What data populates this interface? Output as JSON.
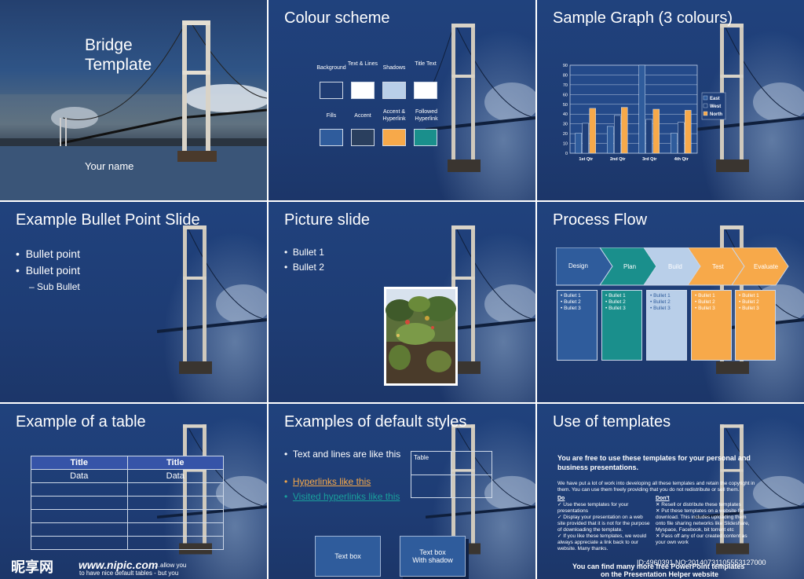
{
  "slide1": {
    "title_line1": "Bridge",
    "title_line2": "Template",
    "subtitle": "Your name"
  },
  "slide2": {
    "title": "Colour scheme",
    "row1_labels": [
      "Background",
      "Text & Lines",
      "Shadows",
      "Title Text"
    ],
    "row2_labels": [
      "Fills",
      "Accent",
      "Accent & Hyperlink",
      "Followed Hyperlink"
    ],
    "row1_colors": [
      "#1f3c73",
      "#ffffff",
      "#b9cfe9",
      "#ffffff"
    ],
    "row2_colors": [
      "#2f5c9c",
      "#2a3f5e",
      "#f7a94a",
      "#1a8f8c"
    ]
  },
  "slide3": {
    "title": "Sample Graph (3 colours)"
  },
  "chart_data": {
    "type": "bar",
    "categories": [
      "1st Qtr",
      "2nd Qtr",
      "3rd Qtr",
      "4th Qtr"
    ],
    "series": [
      {
        "name": "East",
        "values": [
          20.4,
          27.4,
          90,
          20.4
        ],
        "color": "#2f5c9c"
      },
      {
        "name": "West",
        "values": [
          30.6,
          38.6,
          34.6,
          31.6
        ],
        "color": "#1f3f79"
      },
      {
        "name": "North",
        "values": [
          45.9,
          46.9,
          45,
          43.9
        ],
        "color": "#f7a94a"
      }
    ],
    "ylim": [
      0,
      90
    ],
    "yticks": [
      "0",
      "10",
      "20",
      "30",
      "40",
      "50",
      "60",
      "70",
      "80",
      "90"
    ],
    "grid": true,
    "legend": "right"
  },
  "slide4": {
    "title": "Example Bullet Point Slide",
    "bullets": [
      "Bullet point",
      "Bullet point"
    ],
    "sub_bullet": "Sub Bullet"
  },
  "slide5": {
    "title": "Picture slide",
    "bullets": [
      "Bullet 1",
      "Bullet 2"
    ]
  },
  "slide6": {
    "title": "Process Flow",
    "steps": [
      "Design",
      "Plan",
      "Build",
      "Test",
      "Evaluate"
    ],
    "step_colors": [
      "#2f5c9c",
      "#1a8f8c",
      "#b9cfe9",
      "#f7a94a",
      "#f7a94a"
    ],
    "box_items": [
      "Bullet 1",
      "Bullet 2",
      "Bullet 3"
    ]
  },
  "slide7": {
    "title": "Example of a table",
    "header": [
      "Title",
      "Title"
    ],
    "row1": [
      "Data",
      "Data"
    ],
    "footer_line1": "…allow you",
    "footer_line2": "to have nice default tables - but you"
  },
  "slide8": {
    "title": "Examples of default styles",
    "text_lines": "Text and lines are like this",
    "hyperlink": "Hyperlinks like this",
    "visited": "Visited hyperlinks like this",
    "table_label": "Table",
    "textbox": "Text box",
    "textbox_shadow_line1": "Text box",
    "textbox_shadow_line2": "With shadow"
  },
  "slide9": {
    "title": "Use of templates",
    "heading": "You are free to use these templates for your personal and business presentations.",
    "intro": "We have put a lot of work into developing all these templates and retain the copyright in them.  You can use them freely providing that you do not redistribute or sell them.",
    "do_title": "Do",
    "do_items": [
      "Use these templates for your presentations",
      "Display your presentation on a web site provided that it is not for the purpose of downloading the template.",
      "If you like these templates, we would always appreciate a link back to our website.  Many thanks."
    ],
    "dont_title": "Don't",
    "dont_items": [
      "Resell or distribute these templates",
      "Put these templates on a website for download.  This includes uploading them onto file sharing networks like Slideshare, Myspace, Facebook, bit torrent etc",
      "Pass off any of our created content as your own work"
    ],
    "footer_line1": "You can find many more free PowerPoint templates",
    "footer_line2": "on the Presentation Helper website"
  },
  "watermark": {
    "logo": "昵享网",
    "site": "www.nipic.com",
    "id": "ID:4960391 NO:20140731105553127000"
  }
}
